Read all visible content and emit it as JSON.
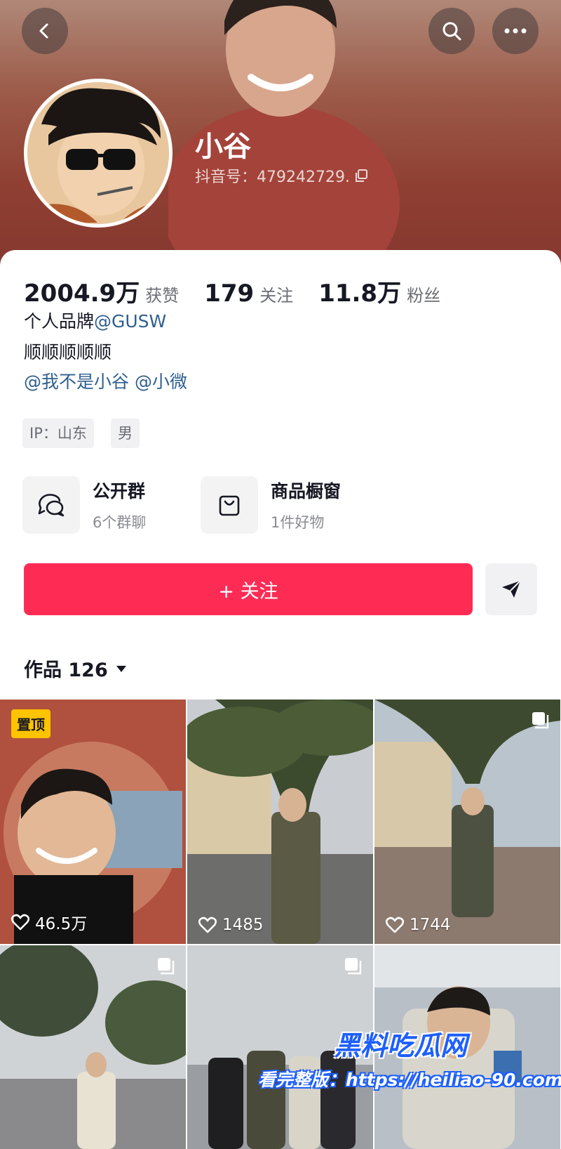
{
  "header": {
    "back_icon": "chevron-left-icon",
    "search_icon": "search-icon",
    "more_icon": "more-horizontal-icon"
  },
  "profile": {
    "name": "小谷",
    "douyin_id": "抖音号：479242729.",
    "copy_icon": "copy-icon"
  },
  "stats": [
    {
      "value": "2004.9万",
      "label": "获赞"
    },
    {
      "value": "179",
      "label": "关注"
    },
    {
      "value": "11.8万",
      "label": "粉丝"
    }
  ],
  "bio": {
    "line1_text": "个人品牌",
    "line1_mention": "@GUSW",
    "line2": "顺顺顺顺顺",
    "mention1": "@我不是小谷",
    "mention2": "@小微"
  },
  "tags": [
    "IP：山东",
    "男"
  ],
  "features": [
    {
      "title": "公开群",
      "subtitle": "6个群聊",
      "icon": "chat-bubbles-icon"
    },
    {
      "title": "商品橱窗",
      "subtitle": "1件好物",
      "icon": "shopping-bag-icon"
    }
  ],
  "actions": {
    "follow_label": "+ 关注",
    "share_icon": "send-icon"
  },
  "works_tab": {
    "label": "作品 126",
    "dropdown_icon": "caret-down-icon"
  },
  "videos": [
    {
      "likes": "46.5万",
      "pinned_label": "置顶"
    },
    {
      "likes": "1485"
    },
    {
      "likes": "1744"
    },
    {
      "likes": ""
    },
    {
      "likes": ""
    },
    {
      "likes": ""
    }
  ],
  "watermark": {
    "title": "黑料吃瓜网",
    "text": "看完整版：https://heiliao-90.com"
  },
  "colors": {
    "accent": "#fe2c55",
    "mention": "#2f5f8f",
    "pin": "#ffc300"
  }
}
